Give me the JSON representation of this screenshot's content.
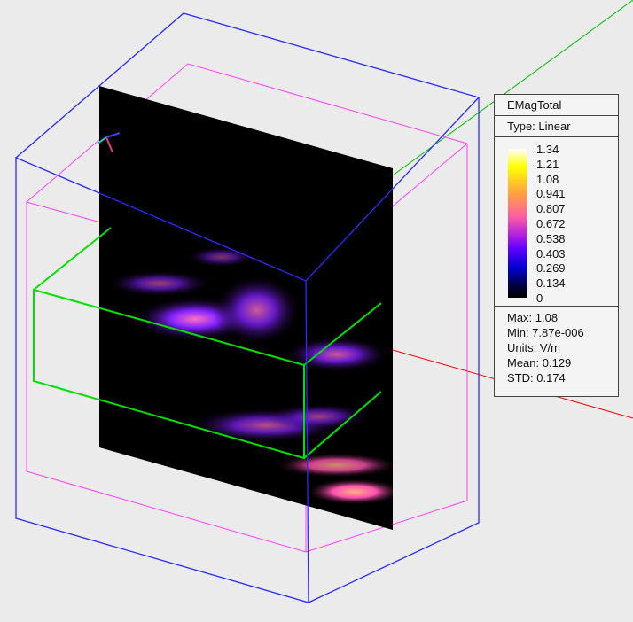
{
  "legend": {
    "title": "EMagTotal",
    "type": "Type: Linear",
    "ticks": [
      "1.34",
      "1.21",
      "1.08",
      "0.941",
      "0.807",
      "0.672",
      "0.538",
      "0.403",
      "0.269",
      "0.134",
      "0"
    ],
    "stats": [
      "Max: 1.08",
      "Min: 7.87e-006",
      "Units: V/m",
      "Mean: 0.129",
      "STD: 0.174"
    ]
  },
  "colors": {
    "outer_box": "#2b2bff",
    "inner_box": "#ff40ff",
    "green_box": "#00e000",
    "x_axis": "#ff0000",
    "y_axis": "#00c000"
  }
}
